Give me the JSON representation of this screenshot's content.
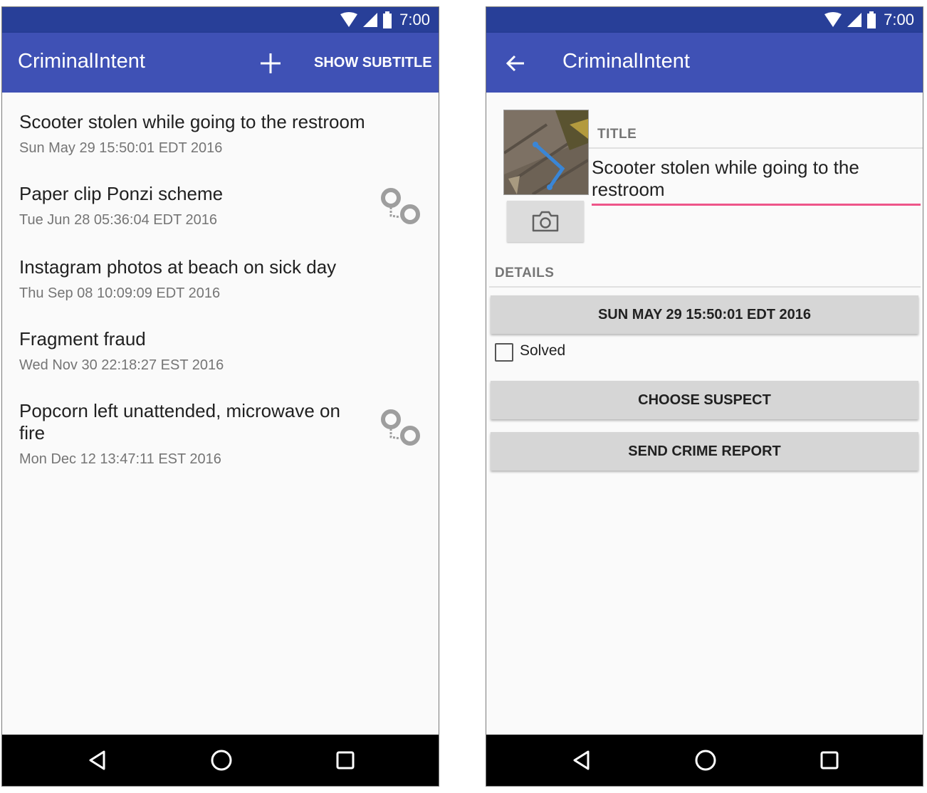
{
  "status": {
    "time": "7:00"
  },
  "list_screen": {
    "title": "CriminalIntent",
    "add_icon": "plus-icon",
    "show_subtitle": "SHOW SUBTITLE",
    "crimes": [
      {
        "title": "Scooter stolen while going to the restroom",
        "date": "Sun May 29 15:50:01 EDT 2016",
        "solved": false
      },
      {
        "title": "Paper clip Ponzi scheme",
        "date": "Tue Jun 28 05:36:04 EDT 2016",
        "solved": true
      },
      {
        "title": "Instagram photos at beach on sick day",
        "date": "Thu Sep 08 10:09:09 EDT 2016",
        "solved": false
      },
      {
        "title": "Fragment fraud",
        "date": "Wed Nov 30 22:18:27 EST 2016",
        "solved": false
      },
      {
        "title": "Popcorn left unattended, microwave on fire",
        "date": "Mon Dec 12 13:47:11 EST 2016",
        "solved": true
      }
    ]
  },
  "detail_screen": {
    "title": "CriminalIntent",
    "back_icon": "arrow-back-icon",
    "title_label": "TITLE",
    "title_value": "Scooter stolen while going to the restroom",
    "details_label": "DETAILS",
    "date_button": "SUN MAY 29 15:50:01 EDT 2016",
    "solved_label": "Solved",
    "solved_checked": false,
    "suspect_button": "CHOOSE SUSPECT",
    "report_button": "SEND CRIME REPORT"
  },
  "nav": {
    "back": "nav-back-icon",
    "home": "nav-home-icon",
    "recents": "nav-recents-icon"
  },
  "colors": {
    "status_bar": "#283f98",
    "app_bar": "#3f51b5",
    "accent": "#e91e63",
    "nav_bar": "#000000"
  }
}
